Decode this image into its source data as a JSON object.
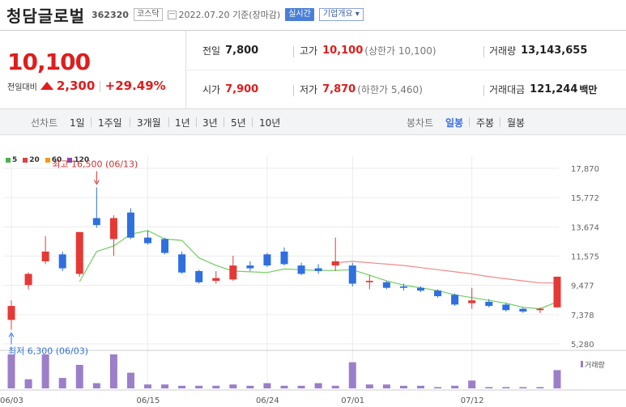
{
  "header": {
    "name": "청담글로벌",
    "code": "362320",
    "market": "코스닥",
    "date": "2022.07.20 기준(장마감)",
    "live_btn": "실시간",
    "info_btn": "기업개요 ▾"
  },
  "quote": {
    "price": "10,100",
    "change_label": "전일대비",
    "change": "2,300",
    "change_pct": "+29.49%",
    "prev_label": "전일",
    "prev": "7,800",
    "high_label": "고가",
    "high": "10,100",
    "upper_limit": "(상한가 10,100)",
    "volume_label": "거래량",
    "volume": "13,143,655",
    "open_label": "시가",
    "open": "7,900",
    "low_label": "저가",
    "low": "7,870",
    "lower_limit": "(하한가 5,460)",
    "amount_label": "거래대금",
    "amount": "121,244",
    "amount_unit": "백만",
    "up_color": "#e01c1c"
  },
  "tabs": {
    "line_label": "선차트",
    "periods": [
      "1일",
      "1주일",
      "3개월",
      "1년",
      "3년",
      "5년",
      "10년"
    ],
    "candle_label": "봉차트",
    "candles": [
      "일봉",
      "주봉",
      "월봉"
    ],
    "candle_active": 0
  },
  "legend": [
    {
      "label": "5",
      "color": "#4caf50"
    },
    {
      "label": "20",
      "color": "#e04040"
    },
    {
      "label": "60",
      "color": "#f39c12"
    },
    {
      "label": "120",
      "color": "#8e44ad"
    }
  ],
  "chart_data": {
    "type": "candlestick",
    "y_ticks": [
      "17,870",
      "15,772",
      "13,674",
      "11,575",
      "9,477",
      "7,378",
      "5,280"
    ],
    "ylim": [
      5280,
      17870
    ],
    "x_labels": [
      {
        "label": "06/03",
        "index": 0
      },
      {
        "label": "06/15",
        "index": 8
      },
      {
        "label": "06/24",
        "index": 15
      },
      {
        "label": "07/01",
        "index": 20
      },
      {
        "label": "07/12",
        "index": 27
      }
    ],
    "high_annotation": {
      "text": "최고 16,500 (06/13)",
      "index": 5,
      "value": 16500
    },
    "low_annotation": {
      "text": "최저 6,300 (06/03)",
      "index": 0,
      "value": 6300
    },
    "volume_label": "거래량",
    "candles": [
      {
        "o": 7000,
        "h": 8400,
        "l": 6300,
        "c": 8000
      },
      {
        "o": 9500,
        "h": 10400,
        "l": 9200,
        "c": 10300
      },
      {
        "o": 11200,
        "h": 13000,
        "l": 11000,
        "c": 11900
      },
      {
        "o": 11700,
        "h": 11900,
        "l": 10500,
        "c": 10700
      },
      {
        "o": 10300,
        "h": 13300,
        "l": 10100,
        "c": 13300
      },
      {
        "o": 14300,
        "h": 16500,
        "l": 13600,
        "c": 13800
      },
      {
        "o": 12800,
        "h": 14500,
        "l": 11600,
        "c": 14300
      },
      {
        "o": 14700,
        "h": 15000,
        "l": 12800,
        "c": 12900
      },
      {
        "o": 12900,
        "h": 13400,
        "l": 12400,
        "c": 12500
      },
      {
        "o": 12800,
        "h": 12900,
        "l": 11700,
        "c": 11800
      },
      {
        "o": 11700,
        "h": 11900,
        "l": 10300,
        "c": 10400
      },
      {
        "o": 10500,
        "h": 10600,
        "l": 9600,
        "c": 9700
      },
      {
        "o": 9800,
        "h": 10500,
        "l": 9600,
        "c": 10000
      },
      {
        "o": 9900,
        "h": 11600,
        "l": 9800,
        "c": 10900
      },
      {
        "o": 10900,
        "h": 11200,
        "l": 10500,
        "c": 10700
      },
      {
        "o": 11700,
        "h": 11800,
        "l": 10800,
        "c": 10900
      },
      {
        "o": 11900,
        "h": 12200,
        "l": 10900,
        "c": 11000
      },
      {
        "o": 10900,
        "h": 11100,
        "l": 10200,
        "c": 10300
      },
      {
        "o": 10700,
        "h": 11000,
        "l": 10300,
        "c": 10500
      },
      {
        "o": 10900,
        "h": 12900,
        "l": 10500,
        "c": 11200
      },
      {
        "o": 10900,
        "h": 11100,
        "l": 9400,
        "c": 9600
      },
      {
        "o": 9700,
        "h": 10200,
        "l": 9200,
        "c": 9800
      },
      {
        "o": 9700,
        "h": 9800,
        "l": 9200,
        "c": 9300
      },
      {
        "o": 9400,
        "h": 9600,
        "l": 9100,
        "c": 9300
      },
      {
        "o": 9300,
        "h": 9400,
        "l": 9000,
        "c": 9100
      },
      {
        "o": 9100,
        "h": 9200,
        "l": 8600,
        "c": 8700
      },
      {
        "o": 8800,
        "h": 8900,
        "l": 8000,
        "c": 8100
      },
      {
        "o": 8200,
        "h": 9300,
        "l": 7800,
        "c": 8400
      },
      {
        "o": 8300,
        "h": 8500,
        "l": 7900,
        "c": 8000
      },
      {
        "o": 8100,
        "h": 8200,
        "l": 7600,
        "c": 7700
      },
      {
        "o": 7800,
        "h": 7900,
        "l": 7500,
        "c": 7600
      },
      {
        "o": 7700,
        "h": 7900,
        "l": 7500,
        "c": 7800
      },
      {
        "o": 7900,
        "h": 10100,
        "l": 7870,
        "c": 10100
      }
    ],
    "volume": [
      13,
      3.5,
      13,
      4,
      9,
      2,
      13,
      6,
      1.5,
      1.5,
      1,
      1,
      1,
      1.5,
      1,
      2,
      1,
      1,
      2,
      1,
      10,
      1.5,
      1.5,
      1,
      1,
      0.5,
      1,
      3,
      0.5,
      0.5,
      0.5,
      0.5,
      7
    ],
    "ma5": [
      null,
      null,
      null,
      null,
      9750,
      11900,
      12300,
      13150,
      13400,
      12800,
      12700,
      11450,
      10900,
      10500,
      10450,
      10400,
      10650,
      10600,
      10550,
      10550,
      10600,
      10200,
      9800,
      9500,
      9300,
      9100,
      8800,
      8600,
      8400,
      8200,
      7900,
      7800,
      8300
    ],
    "ma20": [
      null,
      null,
      null,
      null,
      null,
      null,
      null,
      null,
      null,
      null,
      null,
      null,
      null,
      null,
      null,
      null,
      null,
      null,
      null,
      11100,
      11200,
      11100,
      11000,
      10900,
      10750,
      10600,
      10450,
      10300,
      10100,
      9950,
      9800,
      9650,
      9650
    ]
  }
}
